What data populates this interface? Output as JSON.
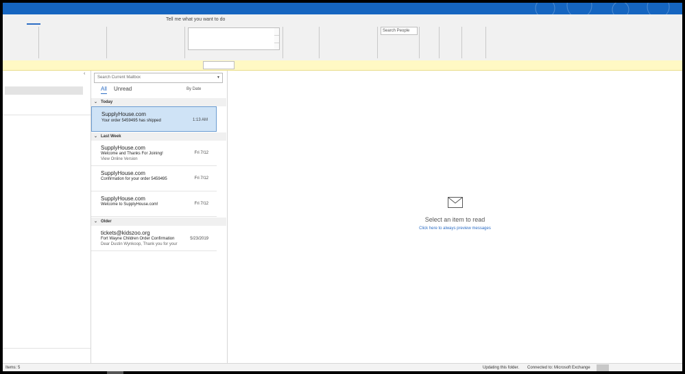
{
  "ribbon": {
    "tell_me": "Tell me what you want to do",
    "search_people_placeholder": "Search People"
  },
  "mail_list": {
    "search_placeholder": "Search Current Mailbox",
    "filters": {
      "all": "All",
      "unread": "Unread"
    },
    "sort_label": "By Date",
    "groups": [
      {
        "header": "Today"
      },
      {
        "header": "Last Week"
      },
      {
        "header": "Older"
      }
    ],
    "items": [
      {
        "sender": "SupplyHouse.com",
        "subject": "Your order 5459495 has shipped",
        "preview": "",
        "date": "1:13 AM"
      },
      {
        "sender": "SupplyHouse.com",
        "subject": "Welcome and Thanks For Joining!",
        "preview": "View Online Version",
        "date": "Fri 7/12"
      },
      {
        "sender": "SupplyHouse.com",
        "subject": "Confirmation for your order 5459495",
        "preview": "",
        "date": "Fri 7/12"
      },
      {
        "sender": "SupplyHouse.com",
        "subject": "Welcome to SupplyHouse.com!",
        "preview": "",
        "date": "Fri 7/12"
      },
      {
        "sender": "tickets@kidszoo.org",
        "subject": "Fort Wayne Children Order Confirmation",
        "preview": "Dear Dustin Wynkoop,  Thank you for your",
        "date": "5/23/2019"
      }
    ]
  },
  "reading_pane": {
    "title": "Select an item to read",
    "link": "Click here to always preview messages"
  },
  "status_bar": {
    "items": "Items: 5",
    "updating": "Updating this folder.",
    "connected": "Connected to: Microsoft Exchange"
  },
  "colors": {
    "accent": "#2b6cc4",
    "title_bar": "#1565c0",
    "info_bar": "#fff9c4",
    "selected_row": "#cfe3f6"
  }
}
